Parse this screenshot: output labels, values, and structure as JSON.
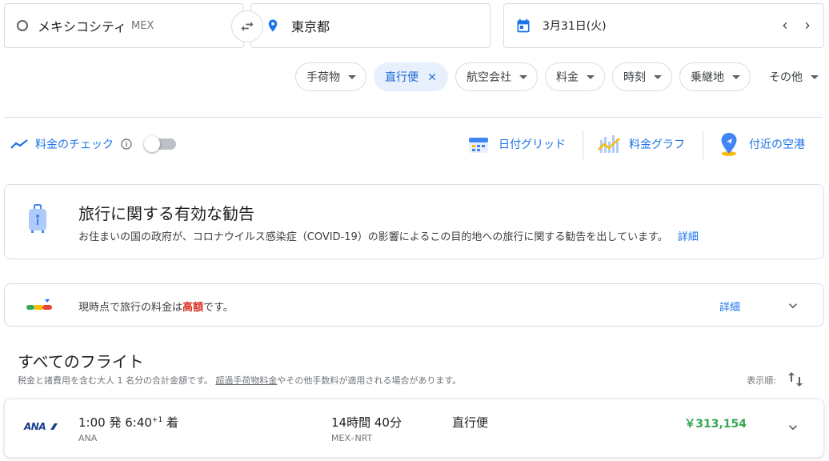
{
  "search": {
    "origin": {
      "city": "メキシコシティ",
      "code": "MEX"
    },
    "destination": {
      "city": "東京都"
    },
    "date": "3月31日(火)"
  },
  "filters": [
    {
      "label": "手荷物",
      "active": false
    },
    {
      "label": "直行便",
      "active": true
    },
    {
      "label": "航空会社",
      "active": false
    },
    {
      "label": "料金",
      "active": false
    },
    {
      "label": "時刻",
      "active": false
    },
    {
      "label": "乗継地",
      "active": false
    },
    {
      "label": "その他",
      "active": false
    }
  ],
  "tools": {
    "track_prices": "料金のチェック",
    "date_grid": "日付グリッド",
    "price_graph": "料金グラフ",
    "nearby_airports": "付近の空港"
  },
  "advisory": {
    "title": "旅行に関する有効な勧告",
    "body": "お住まいの国の政府が、コロナウイルス感染症（COVID-19）の影響によるこの目的地への旅行に関する勧告を出しています。",
    "link": "詳細"
  },
  "price_insight": {
    "prefix": "現時点で旅行の料金は",
    "level": "高額",
    "suffix": "です。",
    "link": "詳細"
  },
  "results": {
    "title": "すべてのフライト",
    "subtitle_prefix": "税金と諸費用を含む大人 1 名分の合計金額です。",
    "subtitle_link": "超過手荷物料金",
    "subtitle_suffix": "やその他手数料が適用される場合があります。",
    "sort_label": "表示順:"
  },
  "flights": [
    {
      "logo": "ANA",
      "depart": "1:00 発 6:40",
      "day_offset": "+1",
      "arrive_suffix": " 着",
      "airline": "ANA",
      "duration": "14時間 40分",
      "route": "MEX–NRT",
      "stops": "直行便",
      "price": "￥313,154"
    }
  ],
  "colors": {
    "accent": "#1a73e8",
    "high_price": "#d93025",
    "price_green": "#34a853",
    "chip_active_bg": "#e8f0fe"
  }
}
